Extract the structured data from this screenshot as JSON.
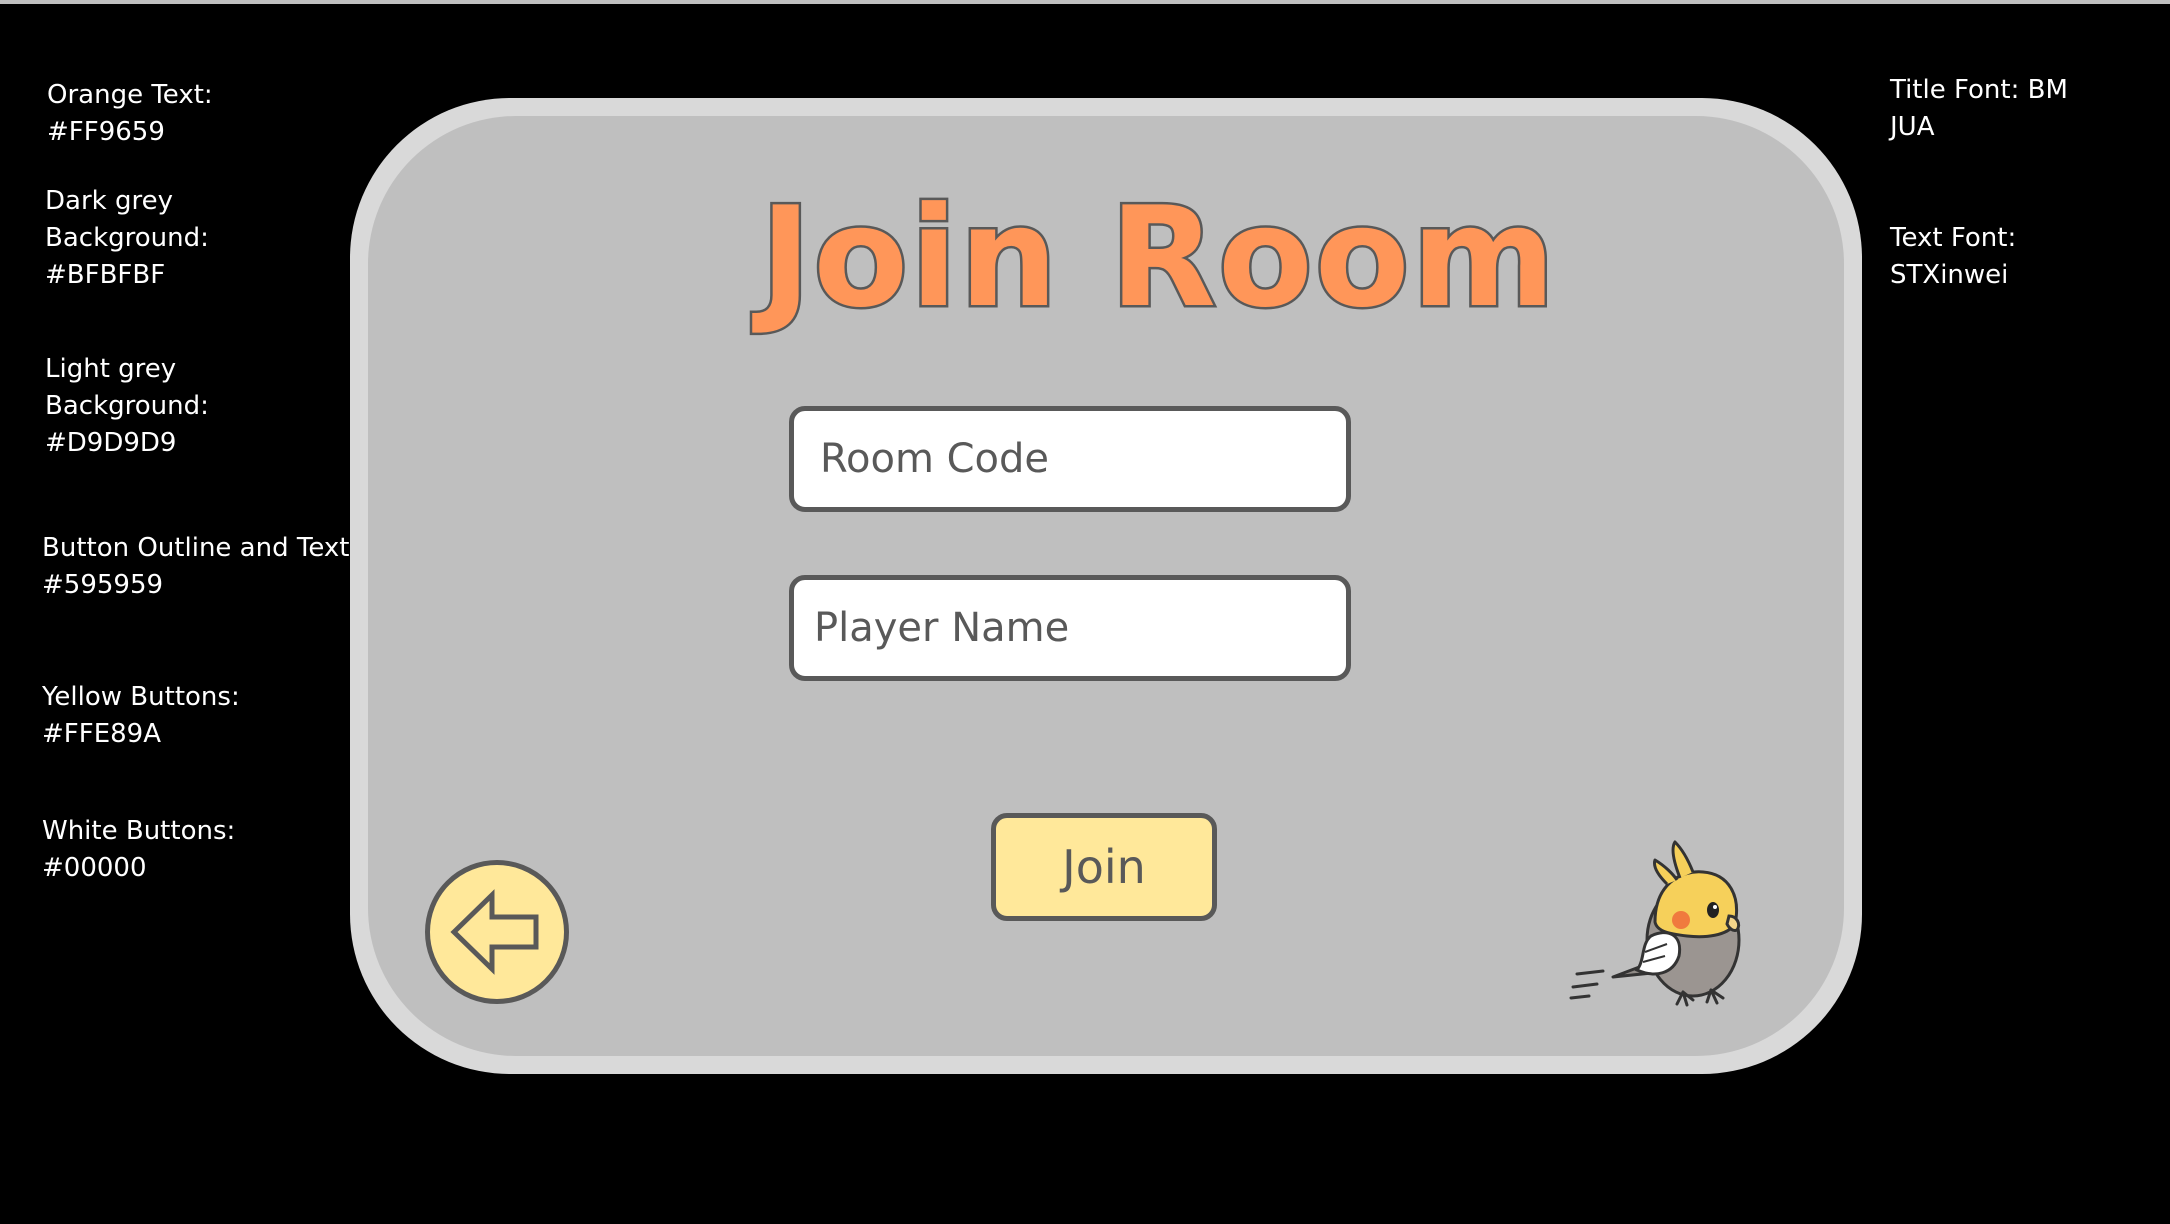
{
  "notes": {
    "left": [
      [
        "Orange Text:",
        "#FF9659"
      ],
      [
        "Dark grey",
        "Background:",
        "#BFBFBF"
      ],
      [
        "Light grey",
        "Background:",
        "#D9D9D9"
      ],
      [
        "Button Outline and Text:",
        "#595959"
      ],
      [
        "Yellow Buttons:",
        "#FFE89A"
      ],
      [
        "White Buttons:",
        "#00000"
      ]
    ],
    "right": [
      [
        "Title Font: BM",
        "JUA"
      ],
      [
        "Text Font:",
        "STXinwei"
      ]
    ]
  },
  "screen": {
    "title": "Join Room",
    "room_code_placeholder": "Room Code",
    "player_name_placeholder": "Player Name",
    "join_label": "Join",
    "back_icon": "arrow-left-icon",
    "mascot_icon": "cockatiel-mascot-icon"
  },
  "colors": {
    "orange_text": "#FF9659",
    "dark_grey_background": "#BFBFBF",
    "light_grey_background": "#D9D9D9",
    "button_outline_and_text": "#595959",
    "yellow_buttons": "#FFE89A",
    "white_buttons": "#FFFFFF"
  }
}
